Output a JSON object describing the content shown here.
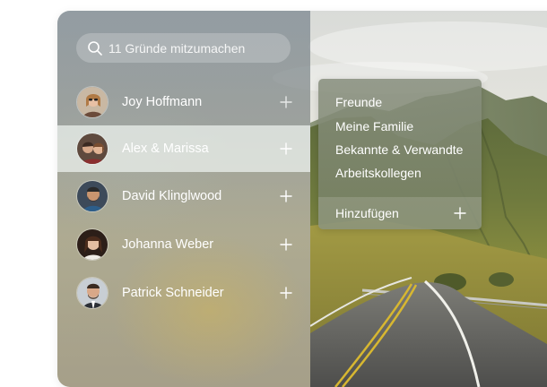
{
  "search": {
    "placeholder": "11 Gründe mitzumachen"
  },
  "contacts": [
    {
      "name": "Joy Hoffmann",
      "avatar": "avatar-joy",
      "selected": false
    },
    {
      "name": "Alex & Marissa",
      "avatar": "avatar-alex-marissa",
      "selected": true
    },
    {
      "name": "David Klinglwood",
      "avatar": "avatar-david",
      "selected": false
    },
    {
      "name": "Johanna Weber",
      "avatar": "avatar-johanna",
      "selected": false
    },
    {
      "name": "Patrick Schneider",
      "avatar": "avatar-patrick",
      "selected": false
    }
  ],
  "groups_menu": {
    "items": [
      {
        "label": "Freunde"
      },
      {
        "label": "Meine Familie"
      },
      {
        "label": "Bekannte & Verwandte"
      },
      {
        "label": "Arbeitskollegen"
      }
    ],
    "add_label": "Hinzufügen"
  },
  "icons": {
    "search": "search-icon",
    "add": "plus-icon"
  },
  "colors": {
    "selected_row": "#eef4f0",
    "text": "#ffffff"
  }
}
